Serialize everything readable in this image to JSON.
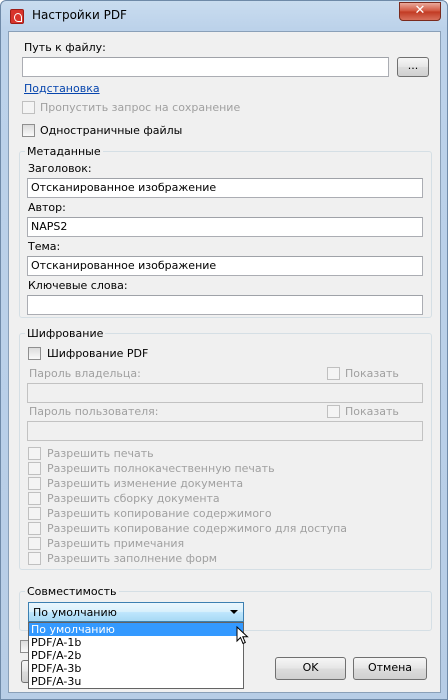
{
  "window": {
    "title": "Настройки PDF",
    "close_label": "✕"
  },
  "path": {
    "label": "Путь к файлу:",
    "value": "",
    "browse_label": "...",
    "substitution_link": "Подстановка"
  },
  "options": {
    "skip_save_prompt": "Пропустить запрос на сохранение",
    "single_page_files": "Одностраничные файлы"
  },
  "metadata": {
    "group_title": "Метаданные",
    "title_label": "Заголовок:",
    "title_value": "Отсканированное изображение",
    "author_label": "Автор:",
    "author_value": "NAPS2",
    "subject_label": "Тема:",
    "subject_value": "Отсканированное изображение",
    "keywords_label": "Ключевые слова:",
    "keywords_value": ""
  },
  "encryption": {
    "group_title": "Шифрование",
    "encrypt_label": "Шифрование PDF",
    "owner_password_label": "Пароль владельца:",
    "user_password_label": "Пароль пользователя:",
    "show_label": "Показать",
    "permissions": [
      "Разрешить печать",
      "Разрешить полнокачественную печать",
      "Разрешить изменение документа",
      "Разрешить сборку документа",
      "Разрешить копирование содержимого",
      "Разрешить копирование содержимого для доступа",
      "Разрешить примечания",
      "Разрешить заполнение форм"
    ]
  },
  "compatibility": {
    "group_title": "Совместимость",
    "selected": "По умолчанию",
    "options": [
      "По умолчанию",
      "PDF/A-1b",
      "PDF/A-2b",
      "PDF/A-3b",
      "PDF/A-3u"
    ]
  },
  "buttons": {
    "ok": "OK",
    "cancel": "Отмена"
  }
}
